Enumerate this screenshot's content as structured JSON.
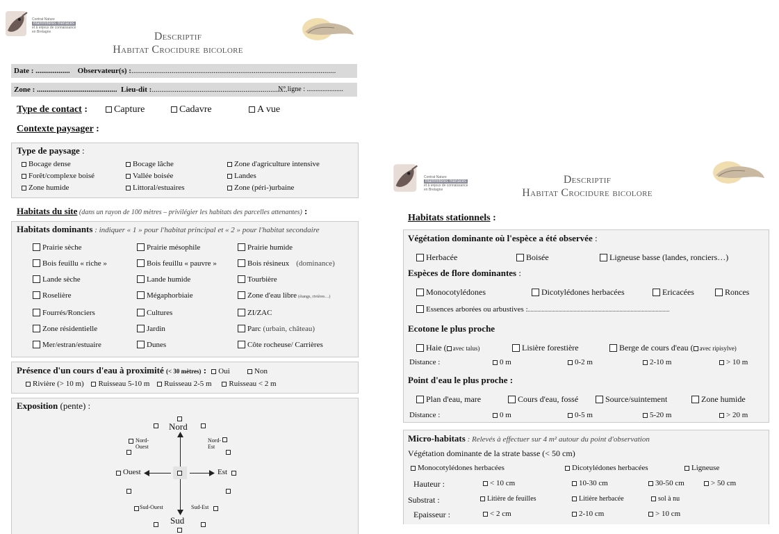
{
  "form1": {
    "logo": {
      "line1": "Contrat Nature",
      "line2": "Mammifères menacés",
      "line3": "et à enjeux de connaissance",
      "line4": "en Bretagne"
    },
    "title_line1": "Descriptif",
    "title_line2": "Habitat Crocidure bicolore",
    "date_label": "Date : ..................",
    "observer_label": "Observateur(s) :",
    "observer_dots": "...........................................................................................................",
    "zone_label": "Zone : ..........................................",
    "lieu_label": "Lieu-dit :",
    "lieu_dots": ".......................................................................",
    "ligne_label": "N° ligne : .....................",
    "contact_label": "Type de contact",
    "contact_colon": " :",
    "contact_options": [
      "Capture",
      "Cadavre",
      "A vue"
    ],
    "contexte_label": "Contexte paysager",
    "contexte_colon": " :",
    "paysage_label": "Type de paysage",
    "paysage_colon": " :",
    "paysage_options": [
      "Bocage dense",
      "Bocage lâche",
      "Zone d'agriculture intensive",
      "Forêt/complexe boisé",
      "Vallée boisée",
      "Landes",
      "Zone humide",
      "Littoral/estuaires",
      "Zone (péri-)urbaine"
    ],
    "habitats_site_label": "Habitats du site",
    "habitats_site_note": " (dans un rayon de 100 mètres – privilégier les habitats des parcelles attenantes)",
    "habitats_site_colon": " :",
    "dominants_label": "Habitats dominants",
    "dominants_note": " : indiquer « 1 » pour l'habitat principal et « 2 » pour l'habitat secondaire",
    "dominants_rows": [
      [
        "Prairie sèche",
        "Prairie mésophile",
        "Prairie humide"
      ],
      [
        "Bois feuillu « riche »",
        "Bois feuillu « pauvre »",
        "Bois résineux"
      ],
      [
        "Lande sèche",
        "Lande humide",
        "Tourbière"
      ],
      [
        "Roselière",
        "Mégaphorbiaie",
        "Zone d'eau libre"
      ],
      [
        "Fourrés/Ronciers",
        "Cultures",
        "ZI/ZAC"
      ],
      [
        "Zone résidentielle",
        "Jardin",
        "Parc"
      ],
      [
        "Mer/estran/estuaire",
        "Dunes",
        "Côte rocheuse/ Carrières"
      ]
    ],
    "dominance_note": "(dominance)",
    "eau_libre_note": "(étangs, rivières…)",
    "parc_note": "(urbain, château)",
    "cours_label": "Présence d'un cours d'eau à proximité",
    "cours_small": "(< 30 mètres)",
    "cours_colon": " :",
    "cours_yesno": [
      "Oui",
      "Non"
    ],
    "cours_options": [
      "Rivière (> 10 m)",
      "Ruisseau 5-10 m",
      "Ruisseau 2-5 m",
      "Ruisseau < 2 m"
    ],
    "exposition_label": "Exposition",
    "exposition_note": " (pente) :",
    "compass": {
      "n": "Nord",
      "s": "Sud",
      "e": "Est",
      "o": "Ouest",
      "ne1": "Nord-",
      "ne2": "Est",
      "no1": "Nord-",
      "no2": "Ouest",
      "se": "Sud-Est",
      "so": "Sud-Ouest"
    }
  },
  "form2": {
    "title_line1": "Descriptif",
    "title_line2": "Habitat Crocidure bicolore",
    "stationnels_label": "Habitats stationnels",
    "stationnels_colon": " :",
    "vegetation_label": "Végétation dominante où l'espèce a été observée",
    "vegetation_colon": " :",
    "vegetation_options": [
      "Herbacée",
      "Boisée",
      "Ligneuse basse (landes, ronciers…)"
    ],
    "flore_label": "Espèces de flore dominantes",
    "flore_colon": " :",
    "flore_options": [
      "Monocotylédones",
      "Dicotylédones herbacées",
      "Ericacées",
      "Ronces"
    ],
    "essences_label": "Essences arborées ou arbustives :",
    "essences_dots": "......................................................................................................",
    "ecotone_label": "Ecotone le plus proche",
    "ecotone_haie": "Haie (",
    "ecotone_talus": "avec talus)",
    "ecotone_lisiere": "Lisière forestière",
    "ecotone_berge": "Berge de cours d'eau (",
    "ecotone_ripisylve": "avec ripisylve)",
    "distance_label": "Distance :",
    "ecotone_distances": [
      "0 m",
      "0-2 m",
      "2-10 m",
      "> 10 m"
    ],
    "point_eau_label": "Point d'eau le plus proche :",
    "point_eau_options": [
      "Plan d'eau, mare",
      "Cours d'eau, fossé",
      "Source/suintement",
      "Zone humide"
    ],
    "point_eau_distances": [
      "0 m",
      "0-5 m",
      "5-20 m",
      "> 20 m"
    ],
    "micro_label": "Micro-habitats",
    "micro_note": " : Relevés à effectuer sur 4 m² autour du point d'observation",
    "strate_label": "Végétation dominante de la strate basse (< 50 cm)",
    "strate_options": [
      "Monocotylédones herbacées",
      "Dicotylédones herbacées",
      "Ligneuse"
    ],
    "hauteur_label": "Hauteur :",
    "hauteur_options": [
      "< 10 cm",
      "10-30 cm",
      "30-50 cm",
      "> 50 cm"
    ],
    "substrat_label": "Substrat :",
    "substrat_options": [
      "Litière de feuilles",
      "Litière herbacée",
      "sol à nu"
    ],
    "epaisseur_label": "Epaisseur :",
    "epaisseur_options": [
      "< 2 cm",
      "2-10 cm",
      "> 10 cm"
    ]
  }
}
